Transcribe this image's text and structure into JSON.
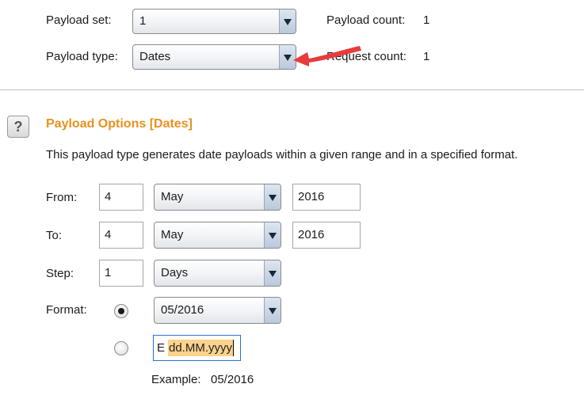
{
  "payload": {
    "set_label": "Payload set:",
    "set_value": "1",
    "count_label": "Payload count:",
    "count_value": "1",
    "type_label": "Payload type:",
    "type_value": "Dates",
    "request_label": "Request count:",
    "request_value": "1"
  },
  "options": {
    "help_glyph": "?",
    "title": "Payload Options [Dates]",
    "description": "This payload type generates date payloads within a given range and in a specified format.",
    "from": {
      "label": "From:",
      "day": "4",
      "month": "May",
      "year": "2016"
    },
    "to": {
      "label": "To:",
      "day": "4",
      "month": "May",
      "year": "2016"
    },
    "step": {
      "label": "Step:",
      "value": "1",
      "unit": "Days"
    },
    "format": {
      "label": "Format:",
      "preset_value": "05/2016",
      "preset_selected": true,
      "custom_prefix": "E",
      "custom_selected_text": "dd.MM.yyyy",
      "custom_selected": false,
      "example_label": "Example:",
      "example_value": "05/2016"
    }
  },
  "annotation": {
    "arrow_color": "#e83b3b"
  },
  "colors": {
    "accent": "#e8911d",
    "focus": "#2f6fd6",
    "highlight": "#fbd38d"
  }
}
